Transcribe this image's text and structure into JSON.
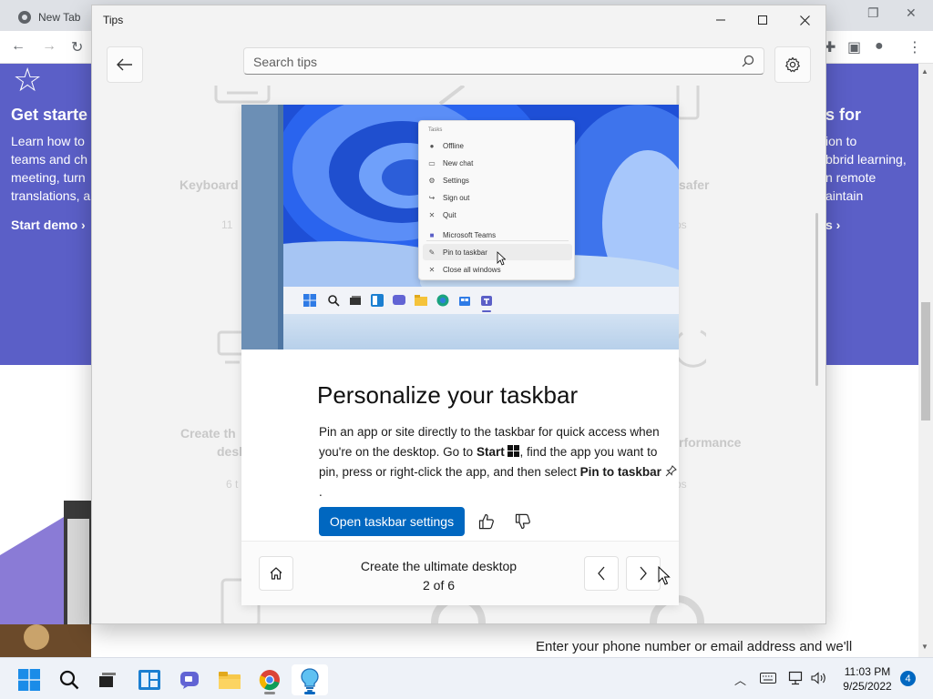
{
  "browser": {
    "tab_title": "New Tab",
    "banner_left": {
      "title": "Get starte",
      "lines": [
        "Learn how to",
        "teams and ch",
        "meeting, turn",
        "translations, a"
      ],
      "link": "Start demo"
    },
    "banner_right": {
      "title": "s for",
      "lines": [
        "ion to",
        "bbrid learning,",
        "n remote",
        "aintain"
      ],
      "link": "s"
    },
    "footer_line": "Enter your phone number or email address and we'll"
  },
  "tips": {
    "window_title": "Tips",
    "search": {
      "placeholder": "Search tips",
      "value": ""
    },
    "ghost_tiles": [
      {
        "title": "Keyboard",
        "sub": "11"
      },
      {
        "title": "safer",
        "sub": "ps"
      },
      {
        "title": "Create th",
        "title2": "desk",
        "sub": "6 t"
      },
      {
        "title": "rformance",
        "sub": "ps"
      }
    ],
    "hero_menu": {
      "header": "Tasks",
      "items": [
        "Offline",
        "New chat",
        "Settings",
        "Sign out",
        "Quit",
        "Microsoft Teams",
        "Pin to taskbar",
        "Close all windows"
      ]
    },
    "card": {
      "title": "Personalize your taskbar",
      "text_1": "Pin an app or site directly to the taskbar for quick access when you're on the desktop. Go to ",
      "start_label": "Start",
      "text_2": ", find the app you want to pin, press or right-click the app, and then select ",
      "pin_label": "Pin to taskbar",
      "text_3": ".",
      "button_label": "Open taskbar settings"
    },
    "footer": {
      "collection_title": "Create the ultimate desktop",
      "position": "2 of 6"
    }
  },
  "taskbar": {
    "time": "11:03 PM",
    "date": "9/25/2022",
    "notification_count": "4",
    "accent": "#0067c0"
  }
}
